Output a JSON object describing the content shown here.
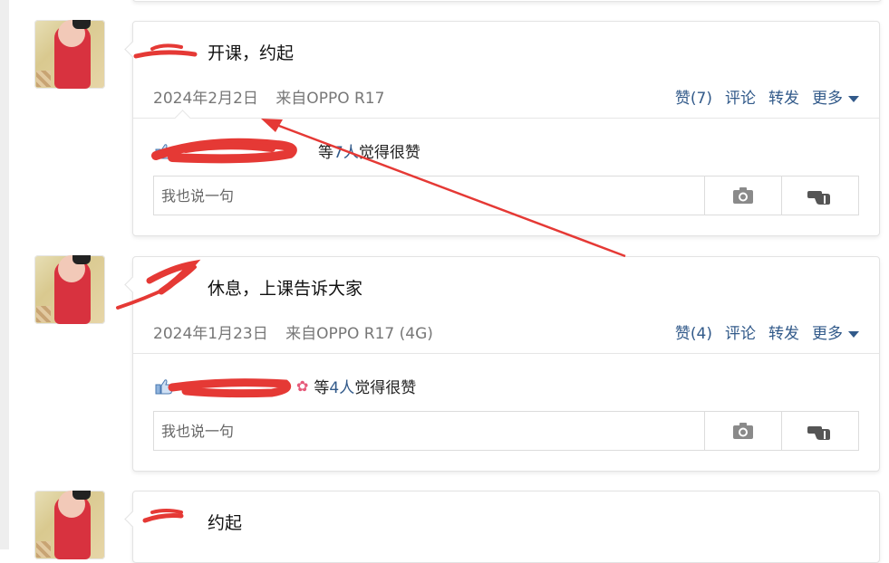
{
  "posts": [
    {
      "text": "开课，约起",
      "date": "2024年2月2日",
      "source": "来自OPPO R17",
      "like_label": "赞(7)",
      "comment_label": "评论",
      "forward_label": "转发",
      "more_label": "更多",
      "likes_prefix": "等",
      "likes_count": "7人",
      "likes_suffix": "觉得很赞",
      "comment_placeholder": "我也说一句"
    },
    {
      "text": "休息，上课告诉大家",
      "date": "2024年1月23日",
      "source": "来自OPPO R17 (4G)",
      "like_label": "赞(4)",
      "comment_label": "评论",
      "forward_label": "转发",
      "more_label": "更多",
      "likes_prefix": "等",
      "likes_count": "4人",
      "likes_suffix": "觉得很赞",
      "comment_placeholder": "我也说一句"
    },
    {
      "text": "约起"
    }
  ],
  "icons": {
    "camera": "camera-icon",
    "hand": "hand-pointing-icon",
    "thumb": "thumbs-up-icon",
    "caret": "caret-down-icon"
  },
  "colors": {
    "link": "#325a8a",
    "meta": "#777777",
    "redaction": "#e53935"
  }
}
